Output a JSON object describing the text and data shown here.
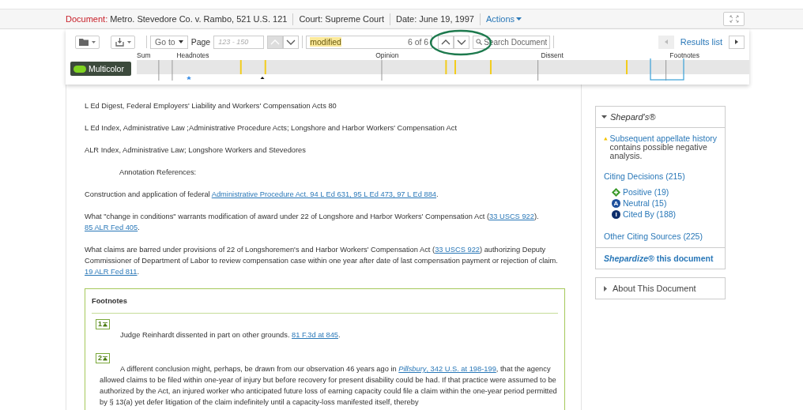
{
  "header": {
    "document_label": "Document:",
    "document": "Metro. Stevedore Co. v. Rambo, 521 U.S. 121",
    "court_label": "Court:",
    "court": "Supreme Court",
    "date_label": "Date:",
    "date": "June 19, 1997",
    "actions": "Actions"
  },
  "toolbar": {
    "goto": "Go to",
    "page_label": "Page",
    "page_placeholder": "123 - 150",
    "search_term": "modified",
    "match_count": "6 of 6",
    "search_placeholder": "Search Document",
    "results_list": "Results list",
    "multicolor": {
      "label": "Multicolor",
      "on": true
    }
  },
  "timeline": {
    "sections": [
      "Sum",
      "Headnotes",
      "Opinion",
      "Dissent",
      "Footnotes"
    ]
  },
  "paragraphs": [
    {
      "kind": "plain",
      "segments": [
        {
          "kind": "text",
          "text": "L Ed Digest, Federal Employers' Liability and Workers' Compensation Acts 80"
        }
      ]
    },
    {
      "kind": "plain",
      "segments": [
        {
          "kind": "text",
          "text": "L Ed Index, Administrative Law ;Administrative Procedure Acts; Longshore and Harbor Workers' Compensation Act"
        }
      ]
    },
    {
      "kind": "plain",
      "segments": [
        {
          "kind": "text",
          "text": "ALR Index, Administrative Law; Longshore Workers and Stevedores"
        }
      ]
    },
    {
      "kind": "indented",
      "segments": [
        {
          "kind": "text",
          "text": "Annotation References:"
        }
      ]
    },
    {
      "kind": "plain",
      "segments": [
        {
          "kind": "text",
          "text": "Construction and application of federal "
        },
        {
          "kind": "link",
          "text": "Administrative Procedure Act. 94 L Ed 631, 95 L Ed 473, 97 L Ed 884"
        },
        {
          "kind": "text",
          "text": "."
        }
      ]
    },
    {
      "kind": "plain",
      "segments": [
        {
          "kind": "text",
          "text": "What \"change in conditions\" warrants modification of award under 22 of Longshore and Harbor Workers' Compensation Act ("
        },
        {
          "kind": "link",
          "text": "33 USCS 922"
        },
        {
          "kind": "text",
          "text": "). "
        },
        {
          "kind": "link",
          "text": "85 ALR Fed 405"
        },
        {
          "kind": "text",
          "text": "."
        }
      ]
    },
    {
      "kind": "plain",
      "segments": [
        {
          "kind": "text",
          "text": "What claims are barred under provisions of 22 of Longshoremen's and Harbor Workers' Compensation Act ("
        },
        {
          "kind": "link",
          "text": "33 USCS 922"
        },
        {
          "kind": "text",
          "text": ") authorizing Deputy Commissioner of Department of Labor to review compensation case within one year after date of last compensation payment or rejection of claim. "
        },
        {
          "kind": "link",
          "text": "19 ALR Fed 811"
        },
        {
          "kind": "text",
          "text": "."
        }
      ]
    }
  ],
  "footnotes": {
    "title": "Footnotes",
    "items": [
      {
        "number": "1",
        "segments": [
          {
            "kind": "text",
            "text": "Judge Reinhardt dissented in part on other grounds. "
          },
          {
            "kind": "link",
            "text": "81 F.3d at 845"
          },
          {
            "kind": "text",
            "text": "."
          }
        ]
      },
      {
        "number": "2",
        "segments": [
          {
            "kind": "text",
            "text": "A different conclusion might, perhaps, be drawn from our observation 46 years ago in "
          },
          {
            "kind": "link",
            "text": "*Pillsbury*, 342 U.S. at 198-199"
          },
          {
            "kind": "text",
            "text": ", that the agency allowed claims to be filed within one-year of injury but before recovery for present disability could be had. If that practice were assumed to be authorized by the Act, an injured worker who anticipated future loss of earning capacity could file a claim within the one-year period permitted by § 13(a) yet defer litigation of the claim indefinitely until a capacity-loss manifested itself, thereby"
          }
        ]
      }
    ]
  },
  "shepards": {
    "title": "Shepard's®",
    "expanded": true,
    "alert_link": "Subsequent appellate history",
    "alert_text": "contains possible negative analysis.",
    "citing_decisions": "Citing Decisions (215)",
    "treatments": [
      {
        "kind": "positive",
        "label": "Positive (19)"
      },
      {
        "kind": "neutral",
        "symbol": "A",
        "label": "Neutral (15)"
      },
      {
        "kind": "cited",
        "symbol": "I",
        "label": "Cited By (188)"
      }
    ],
    "other": "Other Citing Sources (225)",
    "shepardize": "*Shepardize®* this document"
  },
  "about": {
    "title": "About This Document",
    "expanded": false
  }
}
